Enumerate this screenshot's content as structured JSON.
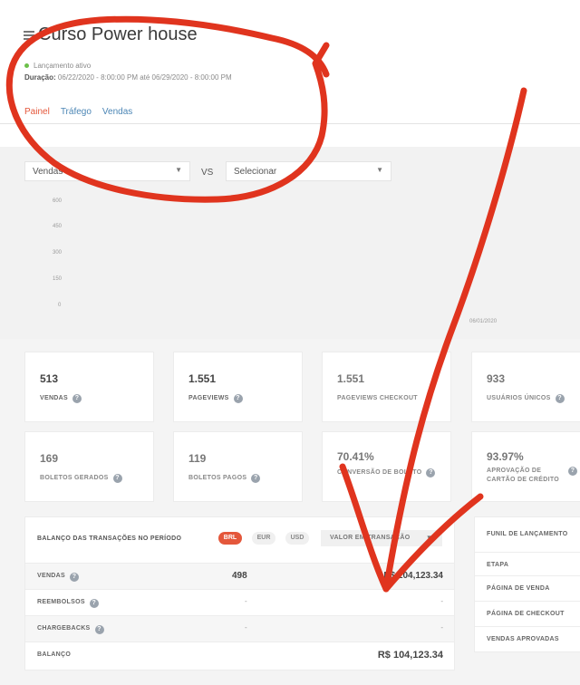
{
  "header": {
    "title": "Curso Power house",
    "status": "Lançamento ativo",
    "duration_label": "Duração:",
    "duration_value": "06/22/2020 - 8:00:00 PM até 06/29/2020 - 8:00:00 PM"
  },
  "tabs": [
    {
      "label": "Painel",
      "active": true
    },
    {
      "label": "Tráfego",
      "active": false
    },
    {
      "label": "Vendas",
      "active": false
    }
  ],
  "filters": {
    "left_select": "Vendas",
    "vs": "VS",
    "right_select": "Selecionar"
  },
  "chart_data": {
    "type": "line",
    "y_ticks": [
      "600",
      "450",
      "300",
      "150",
      "0"
    ],
    "x_ticks": [
      "06/01/2020"
    ],
    "series": []
  },
  "metrics": [
    {
      "value": "513",
      "label": "VENDAS",
      "faded": false
    },
    {
      "value": "1.551",
      "label": "PAGEVIEWS",
      "faded": false
    },
    {
      "value": "1.551",
      "label": "PAGEVIEWS CHECKOUT",
      "faded": true
    },
    {
      "value": "933",
      "label": "USUÁRIOS ÚNICOS",
      "faded": true
    },
    {
      "value": "169",
      "label": "BOLETOS GERADOS",
      "faded": true
    },
    {
      "value": "119",
      "label": "BOLETOS PAGOS",
      "faded": true
    },
    {
      "value": "70.41%",
      "label": "CONVERSÃO DE BOLETO",
      "faded": true
    },
    {
      "value": "93.97%",
      "label": "APROVAÇÃO DE CARTÃO DE CRÉDITO",
      "faded": true
    }
  ],
  "balance": {
    "title": "BALANÇO DAS TRANSAÇÕES NO PERÍODO",
    "currencies": [
      "BRL",
      "EUR",
      "USD"
    ],
    "dropdown": "VALOR EM TRANSAÇÃO",
    "rows": [
      {
        "label": "VENDAS",
        "count": "498",
        "amount": "R$ 104,123.34"
      },
      {
        "label": "REEMBOLSOS",
        "count": "-",
        "amount": "-"
      },
      {
        "label": "CHARGEBACKS",
        "count": "-",
        "amount": "-"
      },
      {
        "label": "BALANÇO",
        "count": "",
        "amount": "R$ 104,123.34"
      }
    ]
  },
  "funnel": {
    "title": "FUNIL DE LANÇAMENTO",
    "rows": [
      "ETAPA",
      "PÁGINA DE VENDA",
      "PÁGINA DE CHECKOUT",
      "VENDAS APROVADAS"
    ]
  },
  "annotation": {
    "color": "#e0341e"
  }
}
